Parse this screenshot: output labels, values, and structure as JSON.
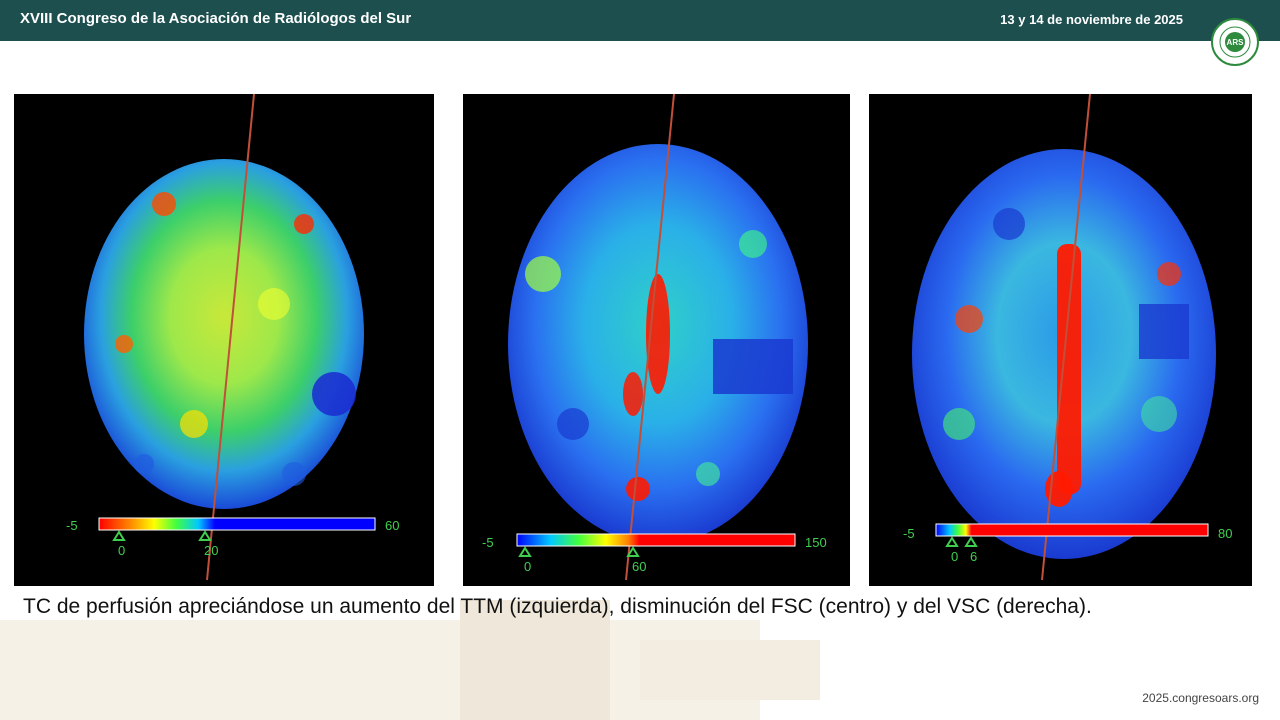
{
  "header": {
    "title": "XVIII Congreso de la Asociación de Radiólogos del Sur",
    "date": "13 y 14 de noviembre de 2025"
  },
  "logo": {
    "text": "ARS",
    "ring_text": "ASOCIACIÓN RADIÓLOGOS SUR"
  },
  "panels": [
    {
      "id": "ttm",
      "scale_min": "-5",
      "scale_max": "60",
      "marker1": "0",
      "marker2": "20",
      "colormap": "inverted-rainbow"
    },
    {
      "id": "fsc",
      "scale_min": "-5",
      "scale_max": "150",
      "marker1": "0",
      "marker2": "60",
      "colormap": "rainbow"
    },
    {
      "id": "vsc",
      "scale_min": "-5",
      "scale_max": "80",
      "marker1": "0",
      "marker2": "6",
      "colormap": "rainbow-short"
    }
  ],
  "caption": "TC de perfusión apreciándose un aumento del TTM (izquierda), disminución del FSC (centro) y del VSC (derecha).",
  "footer": {
    "url": "2025.congresoars.org"
  },
  "colors": {
    "header_bg": "#1d4f4f",
    "logo_green": "#2e8b3e",
    "scale_text": "#3fcf4f"
  }
}
